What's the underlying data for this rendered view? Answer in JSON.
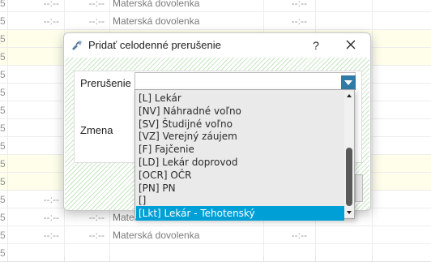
{
  "background_table": {
    "rows": [
      {
        "c0": "5",
        "c1": "--:--",
        "c2": "--:--",
        "c3": "Materská dovolenka",
        "c4": "--:--",
        "yellow": false
      },
      {
        "c0": "5",
        "c1": "--:--",
        "c2": "--:--",
        "c3": "Materská dovolenka",
        "c4": "--:--",
        "yellow": false
      },
      {
        "c0": "5",
        "c1": "",
        "c2": "",
        "c3": "",
        "c4": "",
        "yellow": true
      },
      {
        "c0": "5",
        "c1": "",
        "c2": "",
        "c3": "",
        "c4": "",
        "yellow": true
      },
      {
        "c0": "5",
        "c1": "",
        "c2": "",
        "c3": "",
        "c4": "",
        "yellow": false
      },
      {
        "c0": "5",
        "c1": "",
        "c2": "",
        "c3": "",
        "c4": "",
        "yellow": false
      },
      {
        "c0": "5",
        "c1": "",
        "c2": "",
        "c3": "",
        "c4": "",
        "yellow": false
      },
      {
        "c0": "5",
        "c1": "",
        "c2": "",
        "c3": "",
        "c4": "",
        "yellow": false
      },
      {
        "c0": "5",
        "c1": "",
        "c2": "",
        "c3": "",
        "c4": "",
        "yellow": false
      },
      {
        "c0": "5",
        "c1": "",
        "c2": "",
        "c3": "",
        "c4": "",
        "yellow": true
      },
      {
        "c0": "5",
        "c1": "",
        "c2": "",
        "c3": "",
        "c4": "",
        "yellow": true
      },
      {
        "c0": "5",
        "c1": "--:--",
        "c2": "--:--",
        "c3": "Materská dovolenka",
        "c4": "--:--",
        "yellow": false
      },
      {
        "c0": "5",
        "c1": "--:--",
        "c2": "--:--",
        "c3": "Materská dovolenka",
        "c4": "--:--",
        "yellow": false
      },
      {
        "c0": "5",
        "c1": "--:--",
        "c2": "--:--",
        "c3": "Materská dovolenka",
        "c4": "--:--",
        "yellow": false
      },
      {
        "c0": "5",
        "c1": "",
        "c2": "",
        "c3": "",
        "c4": "",
        "yellow": false
      }
    ]
  },
  "dialog": {
    "title": "Pridať celodenné prerušenie",
    "help_label": "?",
    "icon": "app-tools-icon",
    "close_icon": "close-icon",
    "fields": {
      "prerusenie_label": "Prerušenie",
      "prerusenie_value": "",
      "zmena_label": "Zmena"
    }
  },
  "dropdown": {
    "options": [
      {
        "label": "[L] Lekár",
        "selected": false
      },
      {
        "label": "[NV] Náhradné voľno",
        "selected": false
      },
      {
        "label": "[SV] Študijné voľno",
        "selected": false
      },
      {
        "label": "[VZ] Verejný záujem",
        "selected": false
      },
      {
        "label": "[F] Fajčenie",
        "selected": false
      },
      {
        "label": "[LD] Lekár doprovod",
        "selected": false
      },
      {
        "label": "[OCR] OČR",
        "selected": false
      },
      {
        "label": "[PN] PN",
        "selected": false
      },
      {
        "label": "[]",
        "selected": false
      },
      {
        "label": "[Lkt] Lekár - Tehotenský",
        "selected": true
      }
    ],
    "accent_color": "#00a0d6"
  },
  "colors": {
    "combo_arrow": "#2f7aa6",
    "hatch_green": "#c6e5c1",
    "row_highlight": "#fdfde0"
  }
}
